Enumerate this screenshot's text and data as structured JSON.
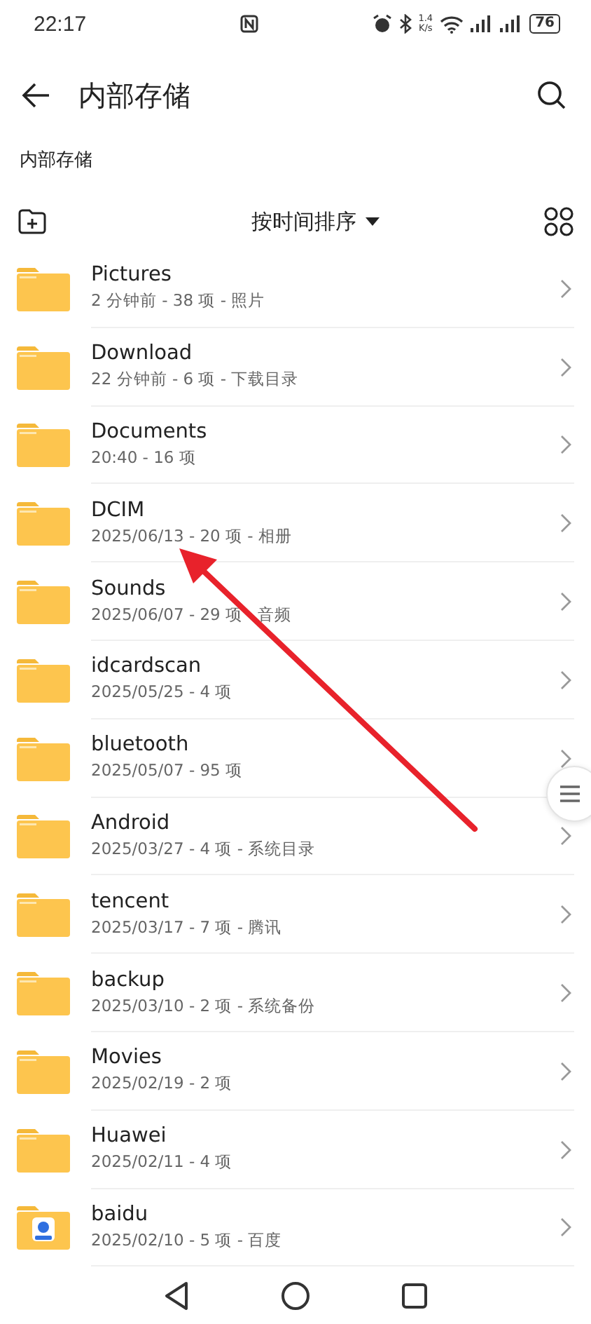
{
  "status_bar": {
    "time": "22:17",
    "speed_value": "1.4",
    "speed_unit": "K/s",
    "battery": "76"
  },
  "header": {
    "title": "内部存储"
  },
  "breadcrumb": "内部存储",
  "toolbar": {
    "sort_label": "按时间排序"
  },
  "folders": [
    {
      "name": "Pictures",
      "info": "2 分钟前 - 38 项 - 照片",
      "kind": "plain"
    },
    {
      "name": "Download",
      "info": "22 分钟前 - 6 项 - 下载目录",
      "kind": "plain"
    },
    {
      "name": "Documents",
      "info": "20:40 - 16 项",
      "kind": "plain"
    },
    {
      "name": "DCIM",
      "info": "2025/06/13 - 20 项 - 相册",
      "kind": "plain"
    },
    {
      "name": "Sounds",
      "info": "2025/06/07 - 29 项   音频",
      "kind": "plain"
    },
    {
      "name": "idcardscan",
      "info": "2025/05/25 - 4 项",
      "kind": "plain"
    },
    {
      "name": "bluetooth",
      "info": "2025/05/07 - 95 项",
      "kind": "plain"
    },
    {
      "name": "Android",
      "info": "2025/03/27 - 4 项 - 系统目录",
      "kind": "plain"
    },
    {
      "name": "tencent",
      "info": "2025/03/17 - 7 项 - 腾讯",
      "kind": "plain"
    },
    {
      "name": "backup",
      "info": "2025/03/10 - 2 项 - 系统备份",
      "kind": "plain"
    },
    {
      "name": "Movies",
      "info": "2025/02/19 - 2 项",
      "kind": "plain"
    },
    {
      "name": "Huawei",
      "info": "2025/02/11 - 4 项",
      "kind": "plain"
    },
    {
      "name": "baidu",
      "info": "2025/02/10 - 5 项 - 百度",
      "kind": "app"
    }
  ]
}
